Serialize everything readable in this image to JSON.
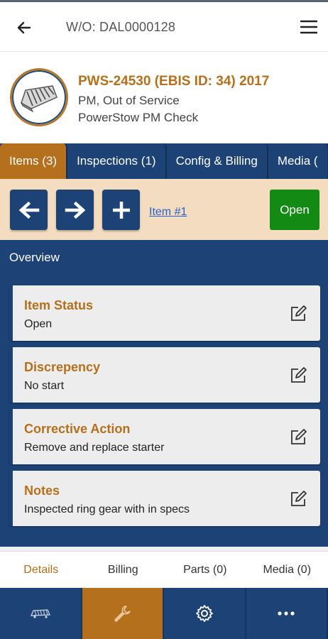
{
  "header": {
    "title": "W/O: DAL0000128",
    "back_icon": "arrow-left-icon",
    "menu_icon": "hamburger-menu-icon"
  },
  "asset": {
    "title": "PWS-24530 (EBIS ID: 34) 2017",
    "status": "PM, Out of Service",
    "description": "PowerStow PM Check",
    "image_icon": "powerstow-conveyor-icon"
  },
  "tabs": [
    {
      "label": "Items (3)",
      "active": true
    },
    {
      "label": "Inspections (1)",
      "active": false
    },
    {
      "label": "Config & Billing",
      "active": false
    },
    {
      "label": "Media (",
      "active": false
    }
  ],
  "toolbar": {
    "prev_icon": "arrow-left-icon",
    "next_icon": "arrow-right-icon",
    "add_icon": "plus-icon",
    "item_link": "Item #1",
    "status_button": "Open"
  },
  "overview": {
    "label": "Overview"
  },
  "cards": [
    {
      "title": "Item Status",
      "value": "Open"
    },
    {
      "title": "Discrepency",
      "value": "No start"
    },
    {
      "title": "Corrective Action",
      "value": "Remove and replace starter"
    },
    {
      "title": "Notes",
      "value": "Inspected ring gear with in specs"
    }
  ],
  "subtabs": [
    {
      "label": "Details",
      "active": true
    },
    {
      "label": "Billing",
      "active": false
    },
    {
      "label": "Parts (0)",
      "active": false
    },
    {
      "label": "Media (0)",
      "active": false
    }
  ],
  "bottom_nav": [
    {
      "icon": "conveyor-icon",
      "active": false
    },
    {
      "icon": "wrench-icon",
      "active": true
    },
    {
      "icon": "gear-icon",
      "active": false
    },
    {
      "icon": "more-dots-icon",
      "active": false
    }
  ],
  "colors": {
    "primary_navy": "#1c4276",
    "accent_orange": "#b4701c",
    "toolbar_bg": "#f3dcc0",
    "open_green": "#138a14",
    "link_blue": "#2a62c9"
  }
}
